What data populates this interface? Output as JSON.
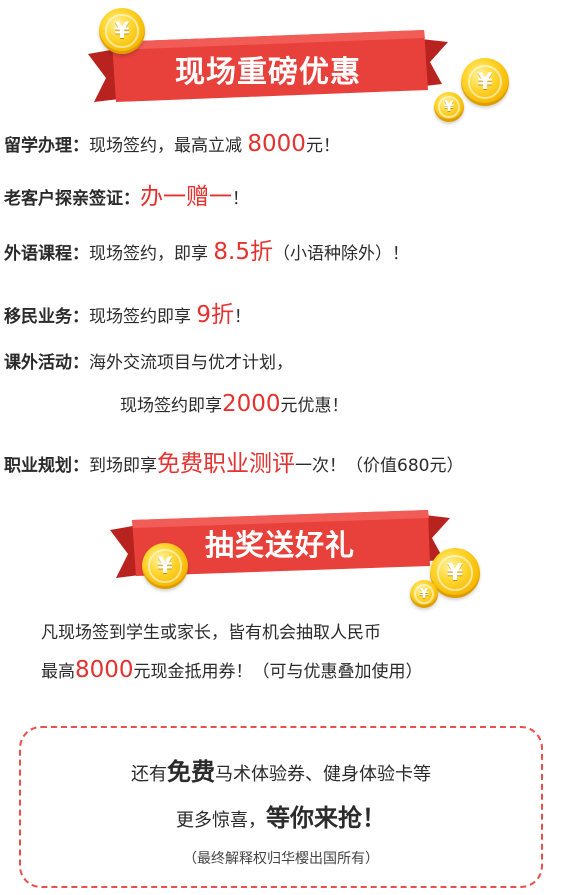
{
  "banner1": {
    "title": "现场重磅优惠"
  },
  "offers": [
    {
      "label": "留学办理：",
      "pre": "现场签约，最高立减 ",
      "highlight": "8000",
      "post": "元！"
    },
    {
      "label": "老客户探亲签证：",
      "pre": "",
      "highlight": "办一赠一",
      "post": "！"
    },
    {
      "label": "外语课程：",
      "pre": "现场签约，即享 ",
      "highlight": "8.5折",
      "post": "（小语种除外）！"
    },
    {
      "label": "移民业务：",
      "pre": "现场签约即享 ",
      "highlight": "9折",
      "post": "！"
    },
    {
      "label": "课外活动：",
      "line1": "海外交流项目与优才计划，",
      "pre": "现场签约即享",
      "highlight": "2000",
      "post": "元优惠！"
    },
    {
      "label": "职业规划：",
      "pre": "到场即享",
      "highlight": "免费职业测评",
      "post": "一次！（价值680元）"
    }
  ],
  "banner2": {
    "title": "抽奖送好礼"
  },
  "lottery": {
    "line1": "凡现场签到学生或家长，皆有机会抽取人民币",
    "line2_pre": "最高",
    "line2_highlight": "8000",
    "line2_post": "元现金抵用券！（可与优惠叠加使用）"
  },
  "box": {
    "line1_pre": "还有",
    "line1_bold": "免费",
    "line1_post": "马术体验券、健身体验卡等",
    "line2_pre": "更多惊喜，",
    "line2_bold": "等你来抢！",
    "note": "（最终解释权归华樱出国所有）"
  },
  "coin_symbol": "¥",
  "colors": {
    "accent_red": "#e3322f",
    "ribbon_red": "#e8413c",
    "ribbon_dark": "#b8231f",
    "coin_gold": "#f5b800",
    "dash_border": "#e8504b"
  },
  "icons": [
    "yuan-coin-icon"
  ]
}
